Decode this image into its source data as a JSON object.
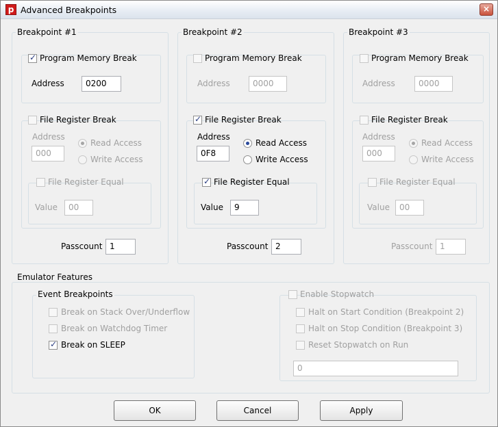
{
  "window": {
    "title": "Advanced Breakpoints",
    "app_icon_glyph": "p",
    "close_glyph": "×"
  },
  "bp1": {
    "title": "Breakpoint #1",
    "pm_label": "Program Memory Break",
    "pm_address_label": "Address",
    "pm_address": "0200",
    "fr_label": "File Register Break",
    "fr_address_label": "Address",
    "fr_address": "000",
    "read_label": "Read Access",
    "write_label": "Write Access",
    "fre_label": "File Register Equal",
    "value_label": "Value",
    "value": "00",
    "passcount_label": "Passcount",
    "passcount": "1"
  },
  "bp2": {
    "title": "Breakpoint #2",
    "pm_label": "Program Memory Break",
    "pm_address_label": "Address",
    "pm_address": "0000",
    "fr_label": "File Register Break",
    "fr_address_label": "Address",
    "fr_address": "0F8",
    "read_label": "Read Access",
    "write_label": "Write Access",
    "fre_label": "File Register Equal",
    "value_label": "Value",
    "value": "9",
    "passcount_label": "Passcount",
    "passcount": "2"
  },
  "bp3": {
    "title": "Breakpoint #3",
    "pm_label": "Program Memory Break",
    "pm_address_label": "Address",
    "pm_address": "0000",
    "fr_label": "File Register Break",
    "fr_address_label": "Address",
    "fr_address": "000",
    "read_label": "Read Access",
    "write_label": "Write Access",
    "fre_label": "File Register Equal",
    "value_label": "Value",
    "value": "00",
    "passcount_label": "Passcount",
    "passcount": "1"
  },
  "emulator": {
    "title": "Emulator Features",
    "events_title": "Event Breakpoints",
    "stack_label": "Break on Stack Over/Underflow",
    "wdt_label": "Break on Watchdog Timer",
    "sleep_label": "Break on SLEEP",
    "stopwatch_label": "Enable Stopwatch",
    "halt_start_label": "Halt on Start Condition (Breakpoint 2)",
    "halt_stop_label": "Halt on Stop Condition (Breakpoint 3)",
    "reset_label": "Reset Stopwatch on Run",
    "stopwatch_value": "0"
  },
  "buttons": {
    "ok": "OK",
    "cancel": "Cancel",
    "apply": "Apply"
  }
}
